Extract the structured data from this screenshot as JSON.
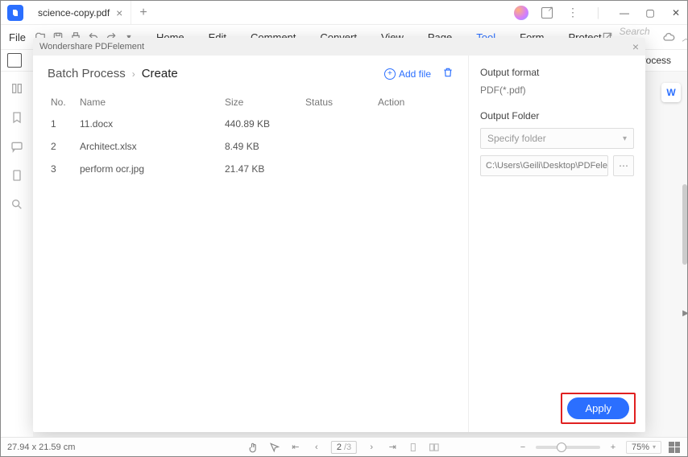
{
  "titlebar": {
    "tab_name": "science-copy.pdf"
  },
  "menu": {
    "file": "File",
    "items": [
      "Home",
      "Edit",
      "Comment",
      "Convert",
      "View",
      "Page",
      "Tool",
      "Form",
      "Protect"
    ],
    "search_placeholder": "Search Tools"
  },
  "toolbar_side": {
    "process": "Process"
  },
  "modal": {
    "title": "Wondershare PDFelement",
    "breadcrumb_root": "Batch Process",
    "breadcrumb_current": "Create",
    "add_file": "Add file",
    "table": {
      "headers": {
        "no": "No.",
        "name": "Name",
        "size": "Size",
        "status": "Status",
        "action": "Action"
      },
      "rows": [
        {
          "no": "1",
          "name": "11.docx",
          "size": "440.89 KB",
          "status": "",
          "action": ""
        },
        {
          "no": "2",
          "name": "Architect.xlsx",
          "size": "8.49 KB",
          "status": "",
          "action": ""
        },
        {
          "no": "3",
          "name": "perform ocr.jpg",
          "size": "21.47 KB",
          "status": "",
          "action": ""
        }
      ]
    },
    "right": {
      "format_label": "Output format",
      "format_value": "PDF(*.pdf)",
      "folder_label": "Output Folder",
      "folder_select": "Specify folder",
      "folder_path": "C:\\Users\\Geili\\Desktop\\PDFelement\\Cr"
    },
    "apply": "Apply"
  },
  "statusbar": {
    "dims": "27.94 x 21.59 cm",
    "page": "2",
    "page_total": "/3",
    "zoom": "75%"
  },
  "right_chip": "W"
}
